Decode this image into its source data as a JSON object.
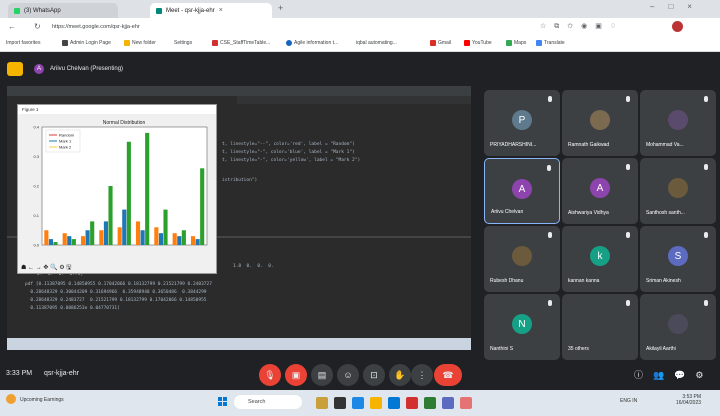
{
  "browser": {
    "tabs": [
      {
        "label": "(3) WhatsApp"
      },
      {
        "label": "Meet - qsr-kjja-ehr"
      }
    ],
    "url": "https://meet.google.com/qsr-kjja-ehr",
    "bookmarks": [
      "Import favorites",
      "Admin Login Page",
      "New folder",
      "Settings",
      "CSE_StaffTimeTable...",
      "Agile information t...",
      "iqbal automating...",
      "Gmail",
      "YouTube",
      "Maps",
      "Translate"
    ]
  },
  "meet": {
    "presenter_label": "Ariivu Chelvan (Presenting)",
    "time": "3:33 PM",
    "meeting_code": "qsr-kjja-ehr",
    "participants": [
      {
        "name": "PRIYADHARSHINI...",
        "initial": "P",
        "color": "#5f7a8c"
      },
      {
        "name": "Ramnath Gaikwad",
        "initial": "",
        "color": "#7b6a4f"
      },
      {
        "name": "Mohammad Va...",
        "initial": "",
        "color": "#5a4a6b"
      },
      {
        "name": "Ariivu Chelvan",
        "initial": "A",
        "color": "#8e44ad"
      },
      {
        "name": "Aishwariya Vidhya",
        "initial": "A",
        "color": "#8e44ad"
      },
      {
        "name": "Santhosh santh...",
        "initial": "",
        "color": "#6b5a3c"
      },
      {
        "name": "Rubesh Dhanu",
        "initial": "",
        "color": "#6b5a3c"
      },
      {
        "name": "kannan kanna",
        "initial": "k",
        "color": "#16a085"
      },
      {
        "name": "Sriman Akinesh",
        "initial": "S",
        "color": "#5c6bc0"
      },
      {
        "name": "Nanthini S",
        "initial": "N",
        "color": "#16a085"
      },
      {
        "name": "35 others",
        "initial": "",
        "color": "#3c4043"
      },
      {
        "name": "Akilayil Aarthi",
        "initial": "",
        "color": "#4a4a5a"
      }
    ]
  },
  "shared_screen": {
    "code_lines": [
      "t, linestyle=\"--\", color='red', label = \"Random\")",
      "t, linestyle=\"-\", color='blue', label = \"Mark 1\")",
      "t, linestyle=\"-\", color='yellow', label = \"Mark 2\")",
      "istribution\")"
    ],
    "console_lines": [
      "0.  0.  0.  0.71]",
      "1.8  0.  0.  0.",
      "pdf [0.11387095 0.14850955 0.17042066 0.18132799 0.21521799 0.2403727",
      "  0.28648329 0.30044209 0.31694966  0.35948948 0.3650486  0.3844299",
      "  0.28648329 0.2483727  0.21521799 0.18132799 0.17042066 0.14850955",
      "  0.11387095 0.0086253e 0.04770731]"
    ],
    "figure": {
      "window_title": "Figure 1",
      "toolbar": "☗ ← → ✥ 🔍 ⚙ 🖫"
    }
  },
  "chart_data": {
    "type": "bar",
    "title": "Normal Distribution",
    "legend": [
      "Random",
      "Mark 1",
      "Mark 2"
    ],
    "legend_placement": "top-left",
    "ylim": [
      0,
      0.4
    ],
    "y_ticks": [
      "0.0",
      "0.1",
      "0.2",
      "0.3",
      "0.4"
    ],
    "series": [
      {
        "name": "Random",
        "color": "#ff7f0e",
        "values": [
          0.05,
          0.04,
          0.03,
          0.05,
          0.06,
          0.08,
          0.06,
          0.04,
          0.03
        ]
      },
      {
        "name": "Mark 1",
        "color": "#1f77b4",
        "values": [
          0.02,
          0.03,
          0.05,
          0.08,
          0.12,
          0.05,
          0.04,
          0.03,
          0.02
        ]
      },
      {
        "name": "Mark 2",
        "color": "#2ca02c",
        "values": [
          0.01,
          0.02,
          0.08,
          0.2,
          0.35,
          0.38,
          0.12,
          0.05,
          0.26
        ]
      }
    ]
  },
  "taskbar": {
    "weather": "Upcoming Earnings",
    "search": "Search",
    "time": "3:53 PM",
    "date": "16/04/2023",
    "lang": "ENG IN"
  }
}
